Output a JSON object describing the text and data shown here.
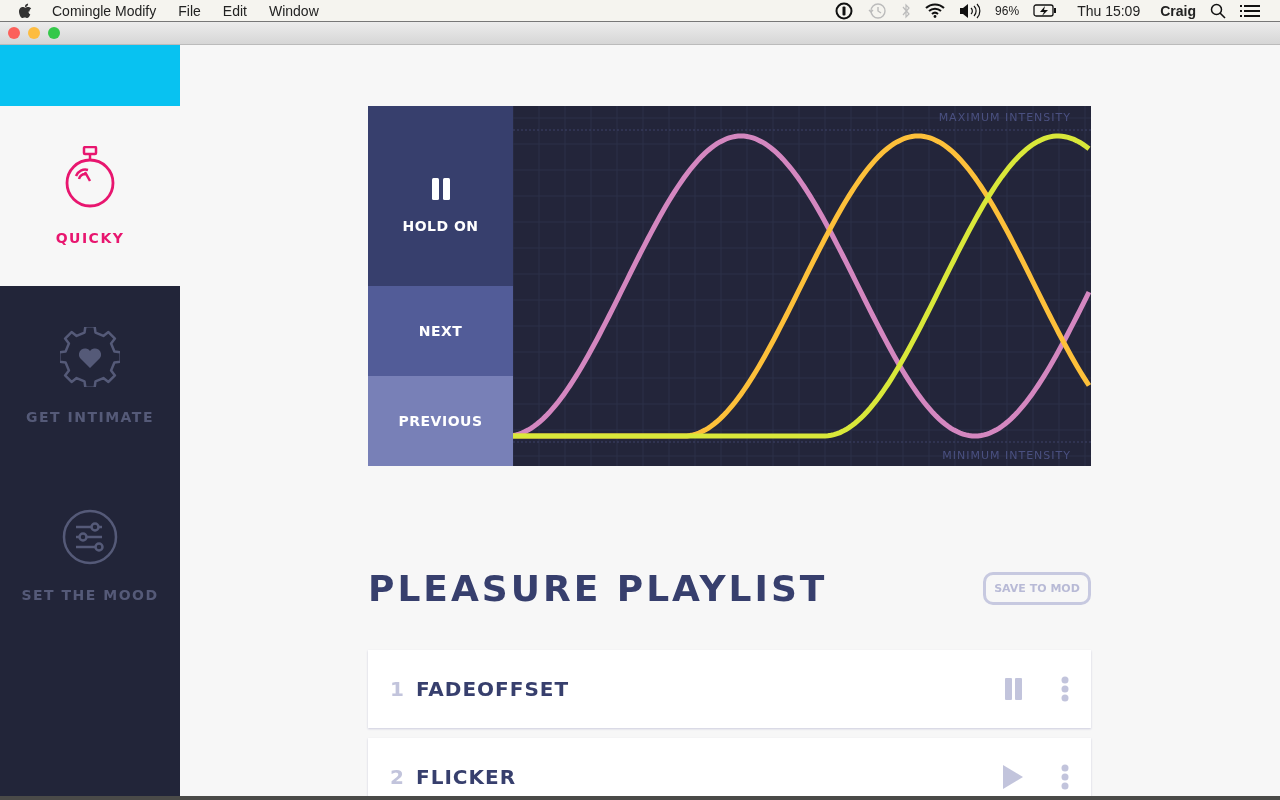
{
  "menubar": {
    "app_name": "Comingle Modify",
    "menus": [
      "File",
      "Edit",
      "Window"
    ],
    "battery": "96%",
    "clock": "Thu 15:09",
    "user": "Craig"
  },
  "sidebar": {
    "items": [
      {
        "label": "QUICKY",
        "kind": "stopwatch",
        "selected": true
      },
      {
        "label": "GET INTIMATE",
        "kind": "gear-heart",
        "selected": false
      },
      {
        "label": "SET THE MOOD",
        "kind": "sliders",
        "selected": false
      }
    ]
  },
  "player": {
    "buttons": [
      {
        "label": "HOLD ON",
        "kind": "pause"
      },
      {
        "label": "NEXT",
        "kind": "next"
      },
      {
        "label": "PREVIOUS",
        "kind": "previous"
      }
    ],
    "max_label": "MAXIMUM INTENSITY",
    "min_label": "MINIMUM INTENSITY"
  },
  "playlist": {
    "title": "PLEASURE PLAYLIST",
    "save_button": "SAVE TO MOD",
    "tracks": [
      {
        "number": "1",
        "name": "FADEOFFSET",
        "playing": true
      },
      {
        "number": "2",
        "name": "FLICKER",
        "playing": false
      }
    ]
  }
}
